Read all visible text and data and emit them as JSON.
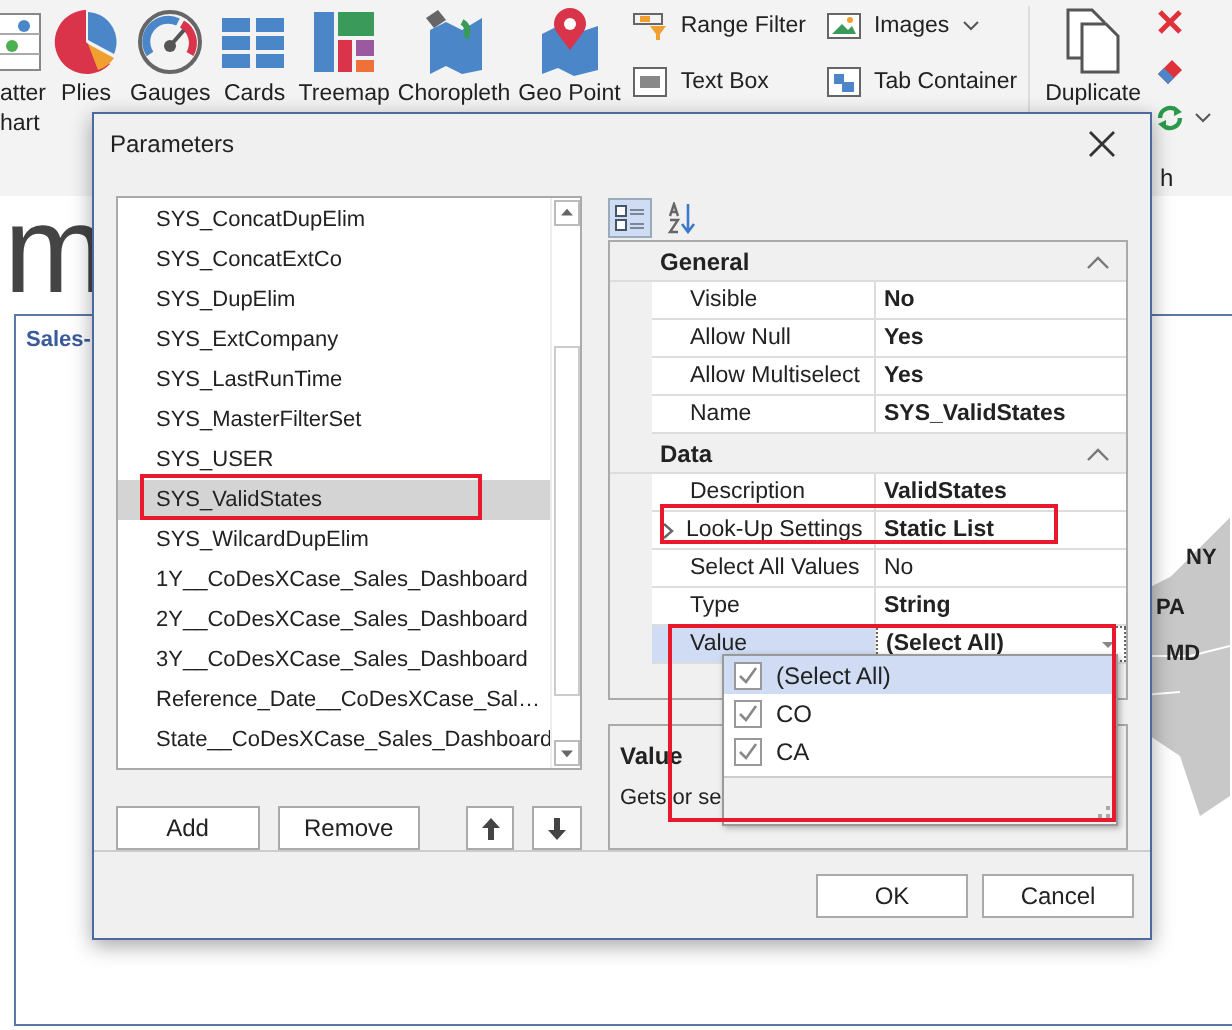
{
  "ribbon": {
    "large_items": [
      {
        "kind": "scatter",
        "lines": [
          "atter",
          "hart"
        ]
      },
      {
        "kind": "pie",
        "lines": [
          "Plies"
        ]
      },
      {
        "kind": "gauge",
        "lines": [
          "Gauges"
        ]
      },
      {
        "kind": "cards",
        "lines": [
          "Cards"
        ]
      },
      {
        "kind": "treemap",
        "lines": [
          "Treemap"
        ]
      },
      {
        "kind": "choropleth",
        "lines": [
          "Choropleth"
        ]
      },
      {
        "kind": "geopoint",
        "lines": [
          "Geo Point"
        ]
      }
    ],
    "small_items": [
      {
        "kind": "range",
        "label": "Range Filter",
        "has_menu": false
      },
      {
        "kind": "images",
        "label": "Images",
        "has_menu": true
      },
      {
        "kind": "textbox",
        "label": "Text Box",
        "has_menu": false
      },
      {
        "kind": "tabs",
        "label": "Tab Container",
        "has_menu": false
      }
    ],
    "duplicate": {
      "label": "Duplicate"
    },
    "group_label": "h"
  },
  "dashboard": {
    "title": "m",
    "panel_title": "Sales-",
    "map_labels": [
      "NY",
      "PA",
      "MD"
    ]
  },
  "dialog": {
    "title": "Parameters",
    "parameters": [
      {
        "name": "SYS_ConcatDupElim",
        "selected": false
      },
      {
        "name": "SYS_ConcatExtCo",
        "selected": false
      },
      {
        "name": "SYS_DupElim",
        "selected": false
      },
      {
        "name": "SYS_ExtCompany",
        "selected": false
      },
      {
        "name": "SYS_LastRunTime",
        "selected": false
      },
      {
        "name": "SYS_MasterFilterSet",
        "selected": false
      },
      {
        "name": "SYS_USER",
        "selected": false
      },
      {
        "name": "SYS_ValidStates",
        "selected": true
      },
      {
        "name": "SYS_WilcardDupElim",
        "selected": false
      },
      {
        "name": "1Y__CoDesXCase_Sales_Dashboard",
        "selected": false
      },
      {
        "name": "2Y__CoDesXCase_Sales_Dashboard",
        "selected": false
      },
      {
        "name": "3Y__CoDesXCase_Sales_Dashboard",
        "selected": false
      },
      {
        "name": "Reference_Date__CoDesXCase_Sal…",
        "selected": false
      },
      {
        "name": "State__CoDesXCase_Sales_Dashboard",
        "selected": false
      }
    ],
    "list_buttons": [
      "Add",
      "Remove"
    ],
    "grid_modes": [
      {
        "kind": "categorized",
        "selected": true
      },
      {
        "kind": "alphabetical",
        "selected": false
      }
    ],
    "categories": [
      {
        "name": "General",
        "expanded": true,
        "properties": [
          {
            "name": "Visible",
            "value": "No",
            "modified": true,
            "selected": false,
            "expandable": false,
            "dropdown": false
          },
          {
            "name": "Allow Null",
            "value": "Yes",
            "modified": true,
            "selected": false,
            "expandable": false,
            "dropdown": false
          },
          {
            "name": "Allow Multiselect",
            "value": "Yes",
            "modified": true,
            "selected": false,
            "expandable": false,
            "dropdown": false
          },
          {
            "name": "Name",
            "value": "SYS_ValidStates",
            "modified": true,
            "selected": false,
            "expandable": false,
            "dropdown": false
          }
        ]
      },
      {
        "name": "Data",
        "expanded": true,
        "properties": [
          {
            "name": "Description",
            "value": "ValidStates",
            "modified": true,
            "selected": false,
            "expandable": false,
            "dropdown": false
          },
          {
            "name": "Look-Up Settings",
            "value": "Static List",
            "modified": true,
            "selected": false,
            "expandable": true,
            "dropdown": false
          },
          {
            "name": "Select All Values",
            "value": "No",
            "modified": false,
            "selected": false,
            "expandable": false,
            "dropdown": false
          },
          {
            "name": "Type",
            "value": "String",
            "modified": true,
            "selected": false,
            "expandable": false,
            "dropdown": false
          },
          {
            "name": "Value",
            "value": "(Select All)",
            "modified": true,
            "selected": true,
            "expandable": false,
            "dropdown": true
          }
        ]
      }
    ],
    "description": {
      "title": "Value",
      "text": "Gets or se"
    },
    "value_options": [
      {
        "label": "(Select All)",
        "checked": true,
        "selected": true
      },
      {
        "label": "CO",
        "checked": true,
        "selected": false
      },
      {
        "label": "CA",
        "checked": true,
        "selected": false
      }
    ],
    "footer_buttons": [
      "OK",
      "Cancel"
    ]
  }
}
